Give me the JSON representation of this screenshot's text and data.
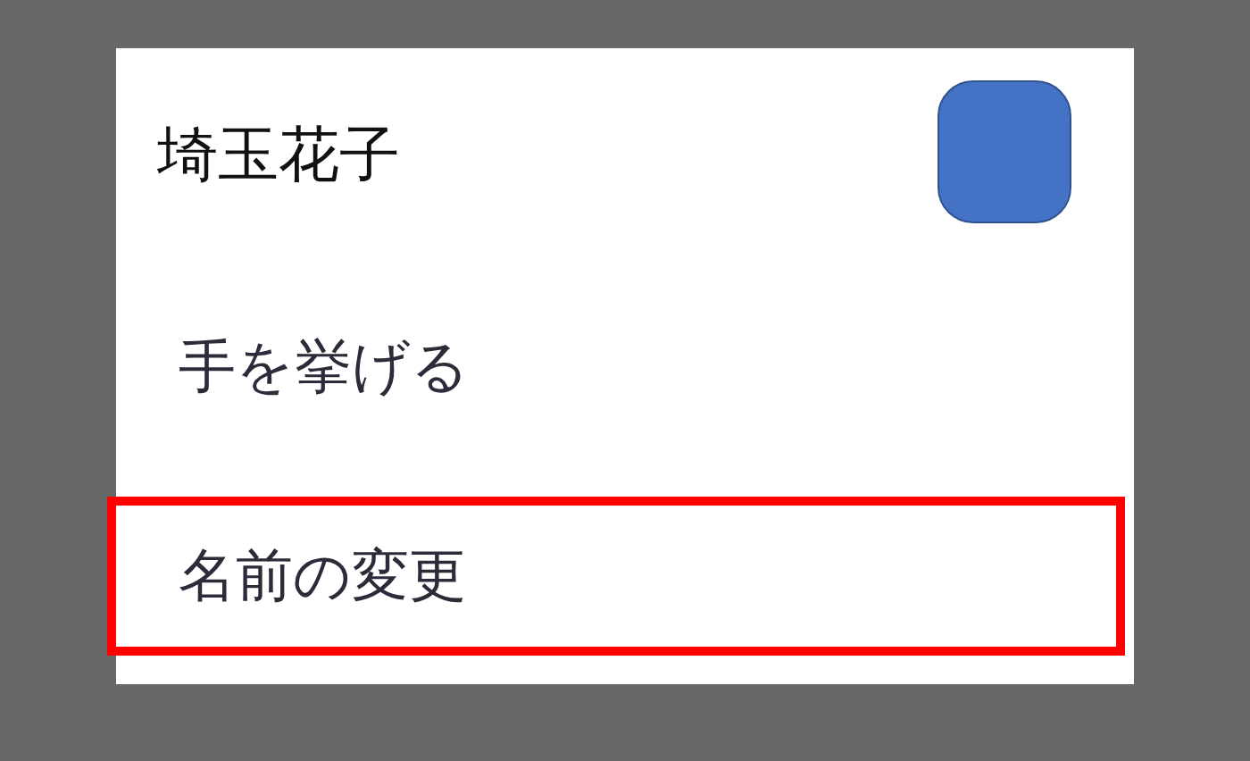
{
  "header": {
    "name": "埼玉花子"
  },
  "menu": [
    {
      "label": "手を挙げる",
      "highlighted": false
    },
    {
      "label": "名前の変更",
      "highlighted": true
    }
  ]
}
